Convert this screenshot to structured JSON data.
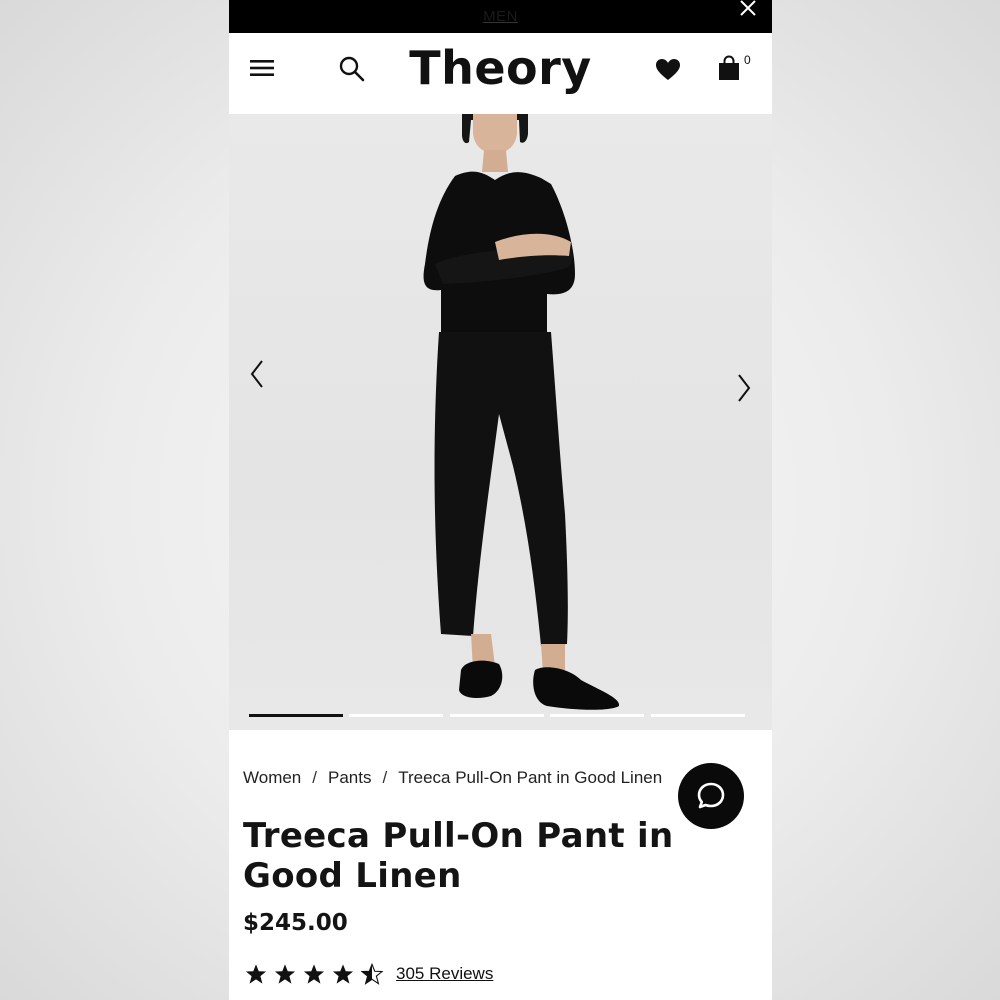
{
  "promo": {
    "link_label": "MEN"
  },
  "header": {
    "logo": "Theory",
    "bag_count": "0"
  },
  "gallery": {
    "slide_count": 5,
    "active_index": 0
  },
  "breadcrumb": {
    "items": [
      "Women",
      "Pants",
      "Treeca Pull-On Pant in Good Linen"
    ],
    "separator": "/"
  },
  "product": {
    "title": "Treeca Pull-On Pant in Good Linen",
    "price": "$245.00",
    "rating": 4.5,
    "reviews_label": "305 Reviews"
  },
  "icons": {
    "menu": "hamburger-menu-icon",
    "search": "search-icon",
    "wishlist": "heart-icon",
    "bag": "shopping-bag-icon",
    "close": "close-icon",
    "chat": "chat-bubble-icon"
  },
  "colors": {
    "text": "#141414",
    "accent": "#000000",
    "background": "#ffffff"
  }
}
